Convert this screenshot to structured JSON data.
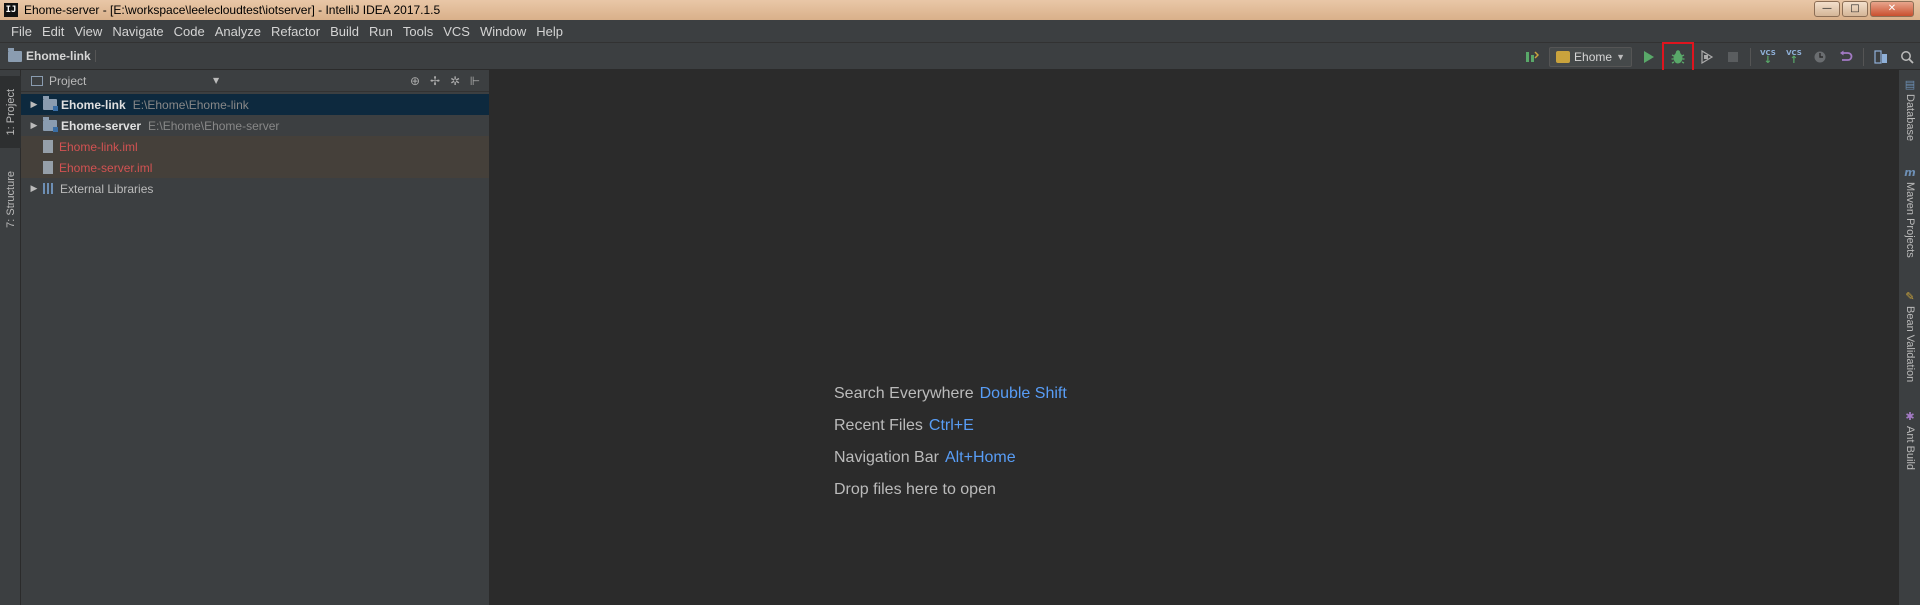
{
  "window": {
    "title": "Ehome-server - [E:\\workspace\\leelecloudtest\\iotserver] - IntelliJ IDEA 2017.1.5",
    "app_icon": "IJ",
    "controls": {
      "minimize": "—",
      "maximize": "□",
      "close": "✕"
    }
  },
  "menu": [
    "File",
    "Edit",
    "View",
    "Navigate",
    "Code",
    "Analyze",
    "Refactor",
    "Build",
    "Run",
    "Tools",
    "VCS",
    "Window",
    "Help"
  ],
  "breadcrumb": {
    "label": "Ehome-link"
  },
  "toolbar": {
    "run_config": "Ehome",
    "icons": [
      "build-icon",
      "run-icon",
      "debug-icon",
      "coverage-icon",
      "stop-icon",
      "vcs-update-icon",
      "vcs-commit-icon",
      "history-icon",
      "revert-icon",
      "project-structure-icon",
      "search-icon"
    ],
    "vcs_label": "VCS"
  },
  "left_tabs": [
    {
      "label": "1: Project"
    },
    {
      "label": "7: Structure"
    }
  ],
  "project_panel": {
    "header": "Project",
    "tree": [
      {
        "name": "Ehome-link",
        "path": "E:\\Ehome\\Ehome-link"
      },
      {
        "name": "Ehome-server",
        "path": "E:\\Ehome\\Ehome-server"
      },
      {
        "name": "Ehome-link.iml"
      },
      {
        "name": "Ehome-server.iml"
      },
      {
        "name": "External Libraries"
      }
    ]
  },
  "editor": {
    "hints": [
      {
        "label": "Search Everywhere",
        "shortcut": "Double Shift"
      },
      {
        "label": "Recent Files",
        "shortcut": "Ctrl+E"
      },
      {
        "label": "Navigation Bar",
        "shortcut": "Alt+Home"
      },
      {
        "label": "Drop files here to open",
        "shortcut": ""
      }
    ]
  },
  "right_tabs": [
    {
      "label": "Database"
    },
    {
      "label": "Maven Projects"
    },
    {
      "label": "Bean Validation"
    },
    {
      "label": "Ant Build"
    }
  ],
  "colors": {
    "accent_link": "#589df6",
    "excluded_file": "#d25252",
    "debug_highlight": "#e0141e",
    "run_green": "#59a869"
  }
}
